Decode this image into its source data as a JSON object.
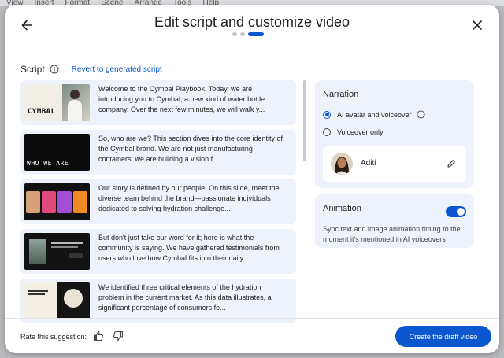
{
  "background": {
    "menu_items": [
      "View",
      "Insert",
      "Format",
      "Scene",
      "Arrange",
      "Tools",
      "Help"
    ]
  },
  "dialog": {
    "title": "Edit script and customize video",
    "step_total": 3,
    "step_current": 3
  },
  "script": {
    "label": "Script",
    "revert_label": "Revert to generated script",
    "scenes": [
      {
        "thumb_text": "CYMBAL",
        "text": "Welcome to the Cymbal Playbook. Today, we are introducing you to Cymbal, a new kind of water bottle company. Over the next few minutes, we will walk y..."
      },
      {
        "thumb_text": "WHO WE ARE",
        "text": "So, who are we? This section dives into the core identity of the Cymbal brand. We are not just manufacturing containers; we are building a vision f..."
      },
      {
        "thumb_text": "",
        "text": "Our story is defined by our people. On this slide, meet the diverse team behind the brand—passionate individuals dedicated to solving hydration challenge..."
      },
      {
        "thumb_text": "",
        "text": "But don't just take our word for it; here is what the community is saying. We have gathered testimonials from users who love how Cymbal fits into their daily..."
      },
      {
        "thumb_text": "",
        "text": "We identified three critical elements of the hydration problem in the current market. As this data illustrates, a significant percentage of consumers fe..."
      }
    ]
  },
  "narration": {
    "title": "Narration",
    "options": [
      {
        "label": "AI avatar and voiceover",
        "selected": true
      },
      {
        "label": "Voiceover only",
        "selected": false
      }
    ],
    "voice_name": "Aditi"
  },
  "animation": {
    "title": "Animation",
    "enabled": true,
    "description": "Sync text and image animation timing to the moment it's mentioned in AI voiceovers"
  },
  "footer": {
    "rate_label": "Rate this suggestion:",
    "create_label": "Create the draft video"
  },
  "colors": {
    "accent": "#0b57d0",
    "card_bg": "#edf2fb"
  }
}
